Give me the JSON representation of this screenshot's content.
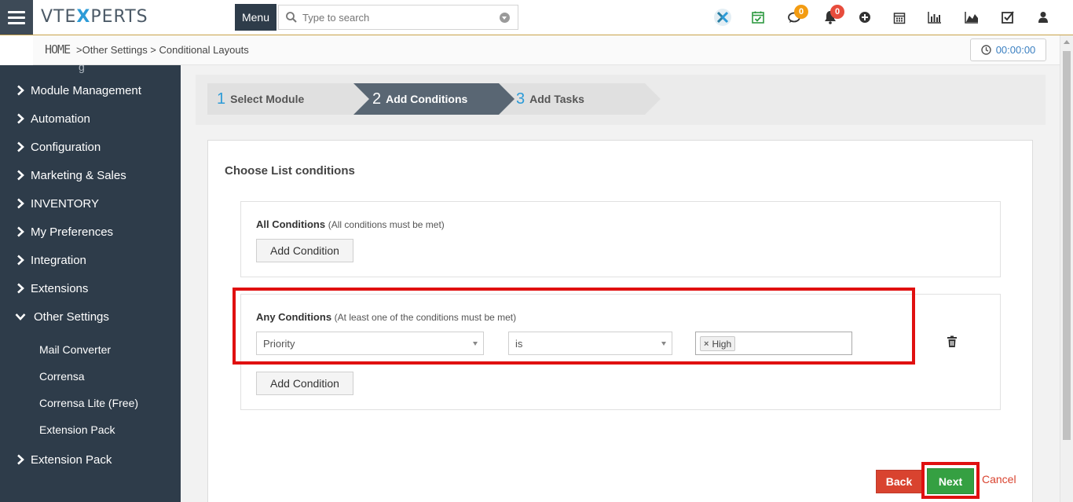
{
  "header": {
    "logo_text": "VTE",
    "logo_x": "X",
    "logo_rest": "PERTS",
    "menu_label": "Menu",
    "search_placeholder": "Type to search",
    "chat_badge": "0",
    "notif_badge": "0",
    "icons": [
      "vtexperts-x-icon",
      "calendar-check-icon",
      "chat-icon",
      "bell-icon",
      "plus-circle-icon",
      "calendar-icon",
      "bar-chart-icon",
      "area-chart-icon",
      "checkbox-icon",
      "user-icon"
    ]
  },
  "breadcrumb": {
    "home": "HOME",
    "path": ">Other Settings >  Conditional Layouts",
    "timer": "00:00:00"
  },
  "sidebar": {
    "items": [
      {
        "label": "Module Management"
      },
      {
        "label": "Automation"
      },
      {
        "label": "Configuration"
      },
      {
        "label": "Marketing & Sales"
      },
      {
        "label": "INVENTORY"
      },
      {
        "label": "My Preferences"
      },
      {
        "label": "Integration"
      },
      {
        "label": "Extensions"
      },
      {
        "label": "Other Settings"
      }
    ],
    "sub_items": [
      {
        "label": "Mail Converter"
      },
      {
        "label": "Corrensa"
      },
      {
        "label": "Corrensa Lite (Free)"
      },
      {
        "label": "Extension Pack"
      }
    ],
    "after_item": "Extension Pack"
  },
  "wizard": {
    "steps": [
      {
        "num": "1",
        "label": "Select Module"
      },
      {
        "num": "2",
        "label": "Add Conditions"
      },
      {
        "num": "3",
        "label": "Add Tasks"
      }
    ]
  },
  "conditions": {
    "title": "Choose List conditions",
    "all": {
      "heading": "All Conditions",
      "sub": "(All conditions must be met)",
      "add_label": "Add Condition"
    },
    "any": {
      "heading": "Any Conditions",
      "sub": "(At least one of the conditions must be met)",
      "field": "Priority",
      "operator": "is",
      "value_tag": "High",
      "tag_remove": "×",
      "add_label": "Add Condition"
    }
  },
  "actions": {
    "back": "Back",
    "next": "Next",
    "cancel": "Cancel"
  },
  "colors": {
    "sidebar_bg": "#2e3c4a",
    "accent_blue": "#2d9bd7",
    "back_red": "#d9432f",
    "next_green": "#35a042",
    "highlight_red": "#e01010"
  }
}
